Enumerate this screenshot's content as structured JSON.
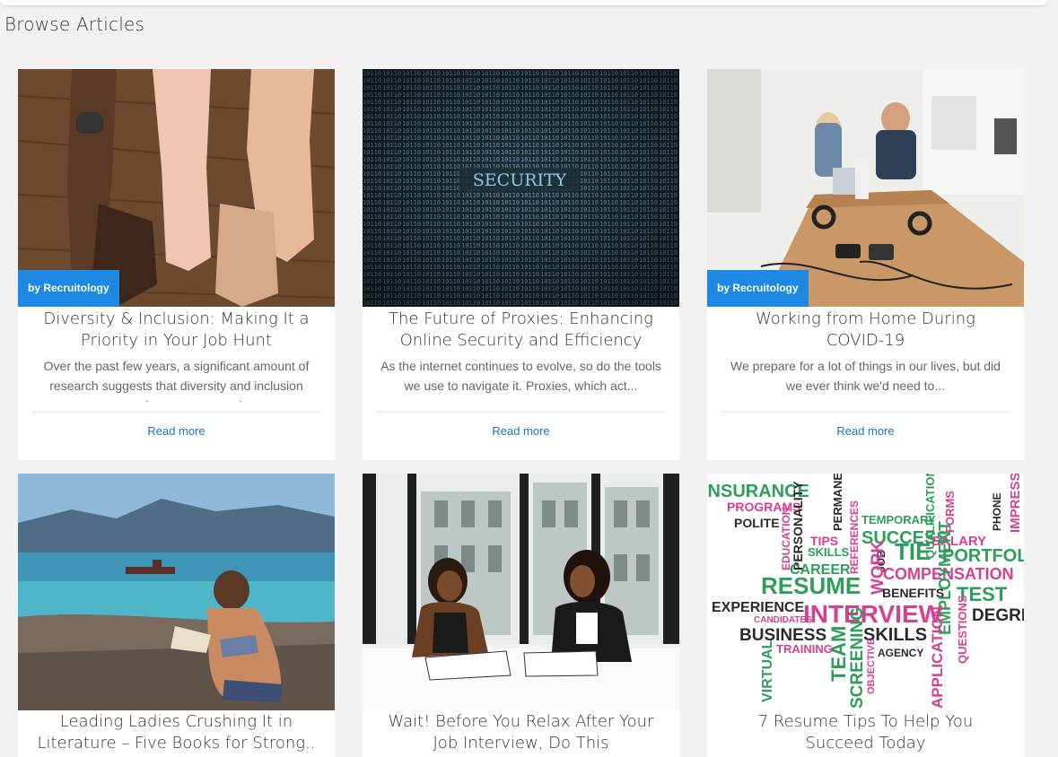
{
  "page": {
    "title": "Browse Articles"
  },
  "articles": [
    {
      "byline": "by Recruitology",
      "title": "Diversity & Inclusion: Making It a Priority in Your Job Hunt",
      "excerpt": "Over the past few years, a significant amount of research suggests that diversity and inclusion measures improve companies...",
      "read_more": "Read more",
      "image": "hands-on-wooden-table"
    },
    {
      "byline": "",
      "title": "The Future of Proxies: Enhancing Online Security and Efficiency",
      "excerpt": "As the internet continues to evolve, so do the tools we use to navigate it. Proxies, which act...",
      "read_more": "Read more",
      "image": "binary-code-security",
      "image_text": "SECURITY"
    },
    {
      "byline": "by Recruitology",
      "title": "Working from Home During COVID-19",
      "excerpt": "We prepare for a lot of things in our lives, but did we ever think we'd need to...",
      "read_more": "Read more",
      "image": "office-desk-headphones"
    },
    {
      "byline": "",
      "title": "Leading Ladies Crushing It in Literature – Five Books for Strong..",
      "image": "woman-reading-on-beach"
    },
    {
      "byline": "",
      "title": "Wait! Before You Relax After Your Job Interview, Do This",
      "image": "two-women-interview"
    },
    {
      "byline": "",
      "title": "7 Resume Tips To Help You Succeed Today",
      "image": "job-word-cloud",
      "word_cloud": [
        "INSURANCE",
        "PROGRAMS",
        "POLITE",
        "EDUCATION",
        "PERSONALITY",
        "TIPS",
        "SKILLS",
        "PERMANENT",
        "REFERENCES",
        "TEMPORARY",
        "SUCCESS",
        "JOB",
        "TIE",
        "QUALIFICATIONS",
        "FORMS",
        "SALARY",
        "PHONE",
        "IMPRESS",
        "PORTFOLIO",
        "CAREER",
        "WORK",
        "COMPENSATION",
        "RESUME",
        "BENEFITS",
        "TEST",
        "EXPERIENCE",
        "CANDIDATES",
        "INTERVIEW",
        "EMPLOYMENT",
        "DEGREE",
        "BUSINESS",
        "TRAINING",
        "TEAM",
        "SKILLS",
        "QUESTIONS",
        "AGENCY",
        "VIRTUAL",
        "SCREENING",
        "OBJECTIVE",
        "APPLICATION"
      ]
    }
  ]
}
